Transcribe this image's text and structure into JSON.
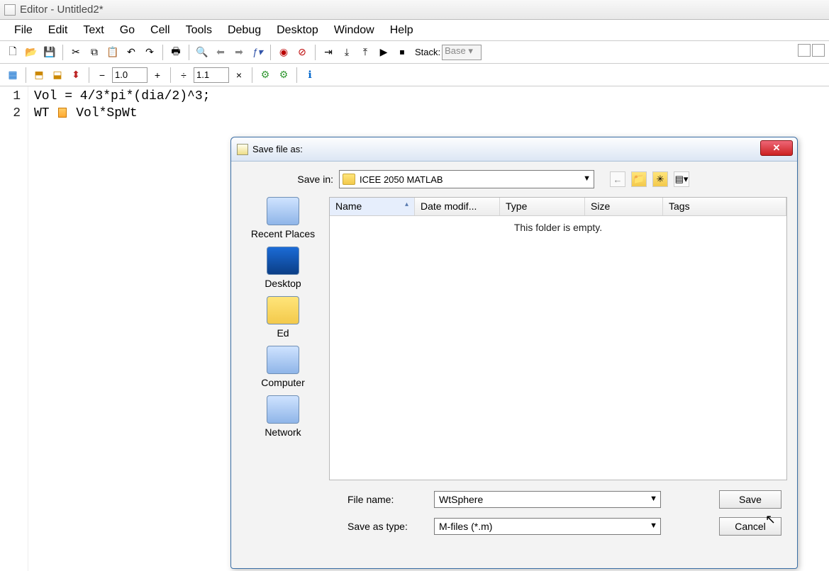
{
  "window": {
    "title": "Editor - Untitled2*"
  },
  "menu": {
    "items": [
      "File",
      "Edit",
      "Text",
      "Go",
      "Cell",
      "Tools",
      "Debug",
      "Desktop",
      "Window",
      "Help"
    ]
  },
  "toolbar1": {
    "stack_label": "Stack:",
    "stack_value": "Base"
  },
  "toolbar2": {
    "val1": "1.0",
    "val2": "1.1"
  },
  "code": {
    "lines": [
      {
        "n": "1",
        "text": "Vol = 4/3*pi*(dia/2)^3;"
      },
      {
        "n": "2",
        "text": "WT ",
        "text2": " Vol*SpWt"
      }
    ]
  },
  "dialog": {
    "title": "Save file as:",
    "save_in_label": "Save in:",
    "save_in_value": "ICEE 2050 MATLAB",
    "places": [
      "Recent Places",
      "Desktop",
      "Ed",
      "Computer",
      "Network"
    ],
    "columns": {
      "name": "Name",
      "date": "Date modif...",
      "type": "Type",
      "size": "Size",
      "tags": "Tags"
    },
    "empty_text": "This folder is empty.",
    "filename_label": "File name:",
    "filename_value": "WtSphere",
    "savetype_label": "Save as type:",
    "savetype_value": "M-files (*.m)",
    "btn_save": "Save",
    "btn_cancel": "Cancel"
  }
}
